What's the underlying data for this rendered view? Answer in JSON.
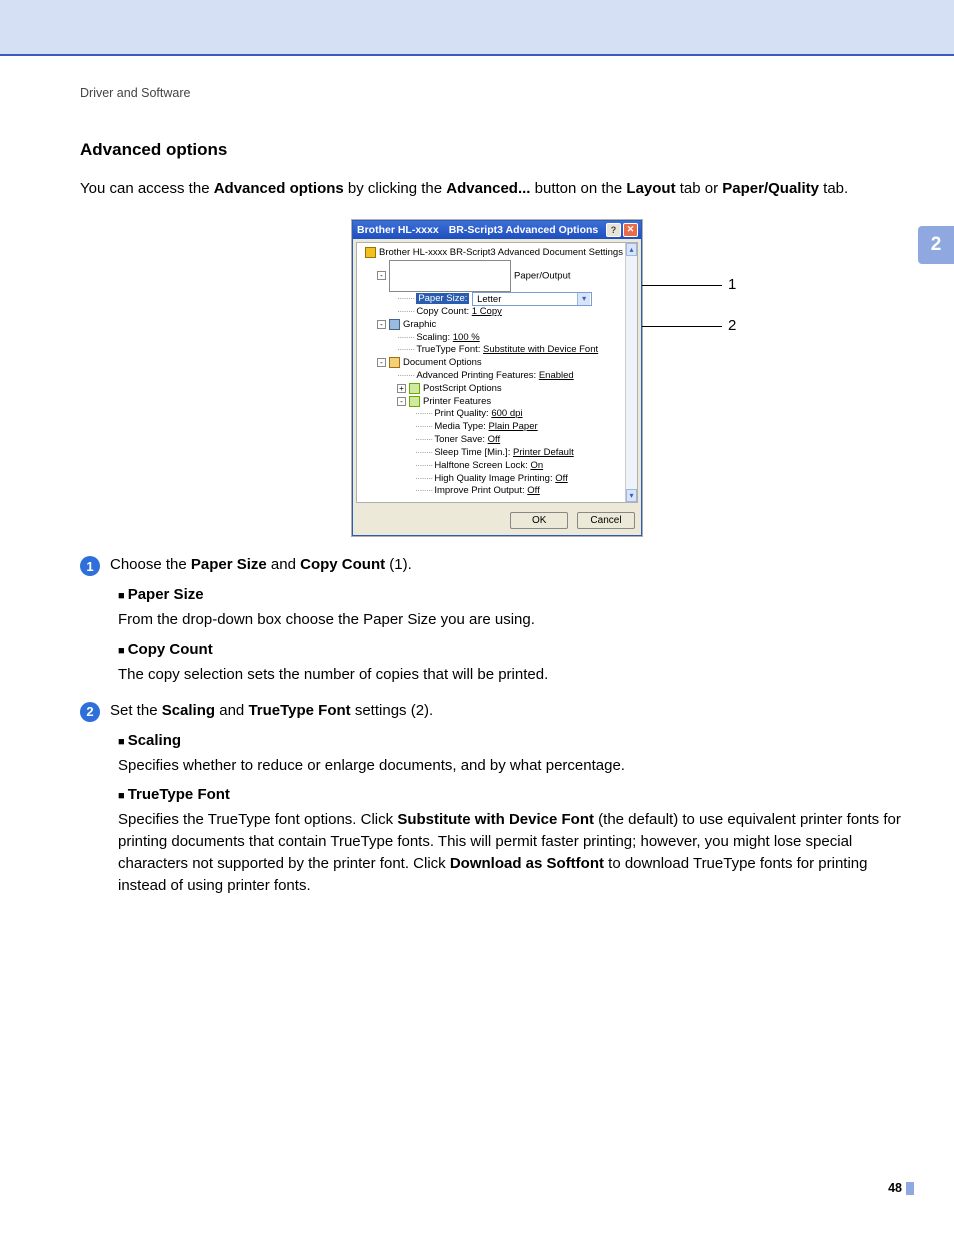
{
  "breadcrumb": "Driver and Software",
  "thumb_tab": "2",
  "page_number": "48",
  "section_title": "Advanced options",
  "intro": {
    "pre": "You can access the ",
    "b1": "Advanced options",
    "mid1": " by clicking the ",
    "b2": "Advanced...",
    "mid2": " button on the ",
    "b3": "Layout",
    "mid3": " tab or ",
    "b4": "Paper/Quality",
    "post": " tab."
  },
  "dialog": {
    "title_left": "Brother HL-xxxx",
    "title_right": "BR-Script3 Advanced Options",
    "help_btn": "?",
    "close_btn": "✕",
    "root": "Brother HL-xxxx    BR-Script3 Advanced Document Settings",
    "paper_output": "Paper/Output",
    "paper_size_label": "Paper Size:",
    "paper_size_value": "Letter",
    "copy_count_label": "Copy Count:",
    "copy_count_value": "1 Copy",
    "graphic": "Graphic",
    "scaling_label": "Scaling:",
    "scaling_value": "100 %",
    "truetype_label": "TrueType Font:",
    "truetype_value": "Substitute with Device Font",
    "doc_options": "Document Options",
    "adv_print_label": "Advanced Printing Features:",
    "adv_print_value": "Enabled",
    "postscript": "PostScript Options",
    "printer_features": "Printer Features",
    "pq_label": "Print Quality:",
    "pq_value": "600 dpi",
    "mt_label": "Media Type:",
    "mt_value": "Plain Paper",
    "ts_label": "Toner Save:",
    "ts_value": "Off",
    "sleep_label": "Sleep Time [Min.]:",
    "sleep_value": "Printer Default",
    "halftone_label": "Halftone Screen Lock:",
    "halftone_value": "On",
    "hq_label": "High Quality Image Printing:",
    "hq_value": "Off",
    "improve_label": "Improve Print Output:",
    "improve_value": "Off",
    "ok": "OK",
    "cancel": "Cancel"
  },
  "callouts": {
    "c1": "1",
    "c2": "2"
  },
  "step1": {
    "num": "1",
    "text_pre": "Choose the ",
    "b1": "Paper Size",
    "mid": " and ",
    "b2": "Copy Count",
    "post": " (1).",
    "paper_size_h": "Paper Size",
    "paper_size_t": "From the drop-down box choose the Paper Size you are using.",
    "copy_count_h": "Copy Count",
    "copy_count_t": "The copy selection sets the number of copies that will be printed."
  },
  "step2": {
    "num": "2",
    "text_pre": "Set the ",
    "b1": "Scaling",
    "mid": " and ",
    "b2": "TrueType Font",
    "post": " settings (2).",
    "scaling_h": "Scaling",
    "scaling_t": "Specifies whether to reduce or enlarge documents, and by what percentage.",
    "tt_h": "TrueType Font",
    "tt_t_pre": "Specifies the TrueType font options. Click ",
    "tt_b1": "Substitute with Device Font",
    "tt_t_mid": " (the default) to use equivalent printer fonts for printing documents that contain TrueType fonts. This will permit faster printing; however, you might lose special characters not supported by the printer font. Click ",
    "tt_b2": "Download as Softfont",
    "tt_t_post": " to download TrueType fonts for printing instead of using printer fonts."
  }
}
